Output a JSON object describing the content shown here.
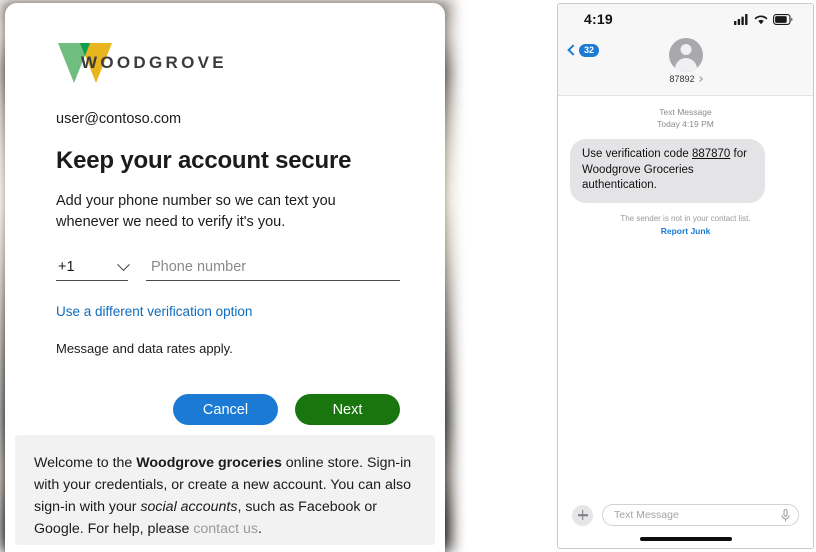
{
  "signin": {
    "logo": {
      "name": "woodgrove-logo",
      "wordmark": "WOODGROVE",
      "colors": {
        "light_green": "#6fbd7f",
        "dark_green": "#0f9d4f",
        "amber": "#e8b51f"
      }
    },
    "email": "user@contoso.com",
    "title": "Keep your account secure",
    "subtitle": "Add your phone number so we can text you whenever we need to verify it's you.",
    "country_code": "+1",
    "phone_placeholder": "Phone number",
    "phone_value": "",
    "alt_option_link": "Use a different verification option",
    "rates_note": "Message and data rates apply.",
    "cancel_label": "Cancel",
    "next_label": "Next",
    "accent_blue": "#1a7ad4",
    "accent_green": "#19760f"
  },
  "footer": {
    "part1": "Welcome to the ",
    "bold1": "Woodgrove groceries",
    "part2": " online store. Sign-in with your credentials, or create a new account. You can also sign-in with your ",
    "italic1": "social accounts",
    "part3": ", such as Facebook or Google. For help, please ",
    "link": "contact us",
    "part4": "."
  },
  "phone": {
    "status": {
      "time": "4:19",
      "signal_icon": "cellular-signal-icon",
      "wifi_icon": "wifi-icon",
      "battery_icon": "battery-icon"
    },
    "header": {
      "back_badge": "32",
      "back_icon": "chevron-left-icon",
      "avatar_icon": "contact-avatar-icon",
      "contact_name": "87892",
      "detail_chevron_icon": "chevron-right-icon"
    },
    "thread": {
      "meta_line1": "Text Message",
      "meta_line2": "Today 4:19 PM",
      "message_prefix": "Use verification code ",
      "message_code": "887870",
      "message_suffix": " for Woodgrove Groceries authentication.",
      "notice": "The sender is not in your contact list.",
      "report_junk": "Report Junk"
    },
    "compose": {
      "plus_icon": "plus-icon",
      "placeholder": "Text Message",
      "mic_icon": "microphone-icon"
    }
  }
}
